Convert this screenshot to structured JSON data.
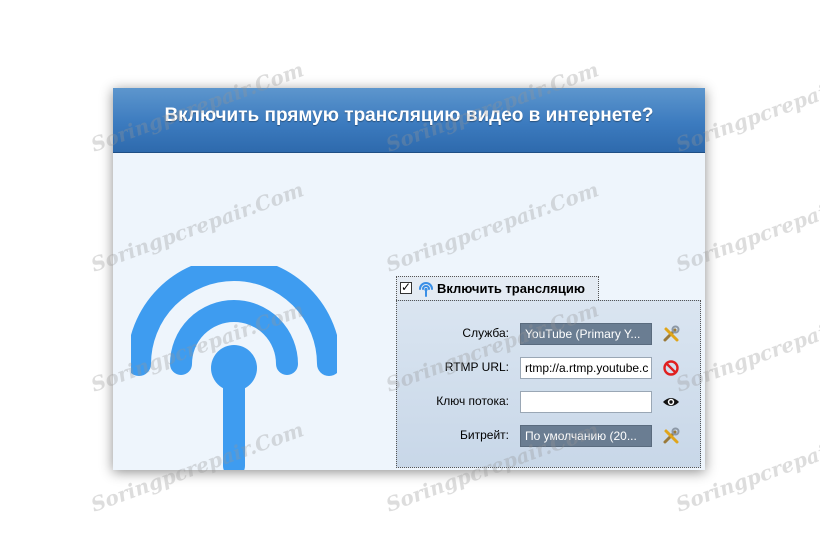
{
  "watermark": "Soringpcrepair.Com",
  "header": {
    "title": "Включить прямую трансляцию видео в интернете?"
  },
  "enable": {
    "checked": "✓",
    "label": "Включить трансляцию"
  },
  "form": {
    "service": {
      "label": "Служба:",
      "value": "YouTube (Primary Y...",
      "icon": "tools-icon"
    },
    "rtmp": {
      "label": "RTMP URL:",
      "value": "rtmp://a.rtmp.youtube.c",
      "icon": "no-entry-icon"
    },
    "key": {
      "label": "Ключ потока:",
      "value": "",
      "icon": "eye-icon"
    },
    "bitrate": {
      "label": "Битрейт:",
      "value": "По умолчанию (20...",
      "icon": "tools-icon"
    }
  },
  "colors": {
    "accent": "#3a8fe6",
    "header": "#3c7bbf"
  }
}
